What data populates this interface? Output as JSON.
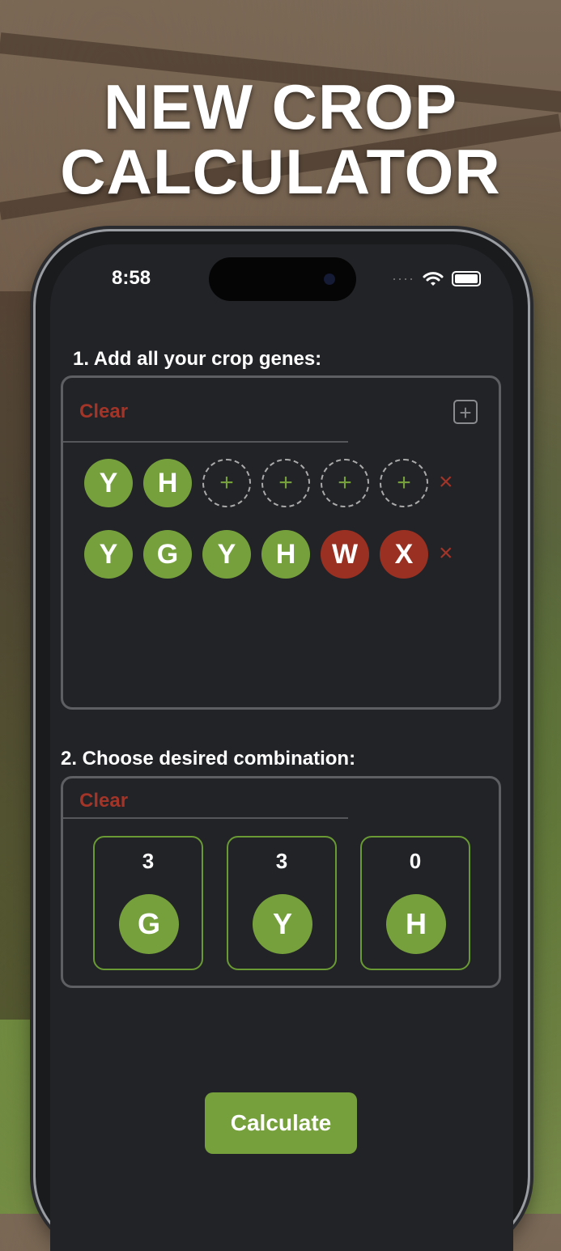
{
  "headline": {
    "line1": "NEW CROP",
    "line2": "CALCULATOR"
  },
  "status_bar": {
    "time": "8:58",
    "signal": "····"
  },
  "step1": {
    "label": "1. Add all your crop genes:",
    "clear": "Clear",
    "add_icon": "plus-square-icon",
    "empty_slot": "+",
    "remove": "×",
    "rows": [
      [
        "Y",
        "H",
        "+",
        "+",
        "+",
        "+"
      ],
      [
        "Y",
        "G",
        "Y",
        "H",
        "W",
        "X"
      ]
    ]
  },
  "step2": {
    "label": "2. Choose desired combination:",
    "clear": "Clear",
    "combos": [
      {
        "count": "3",
        "gene": "G"
      },
      {
        "count": "3",
        "gene": "Y"
      },
      {
        "count": "0",
        "gene": "H"
      }
    ]
  },
  "calculate": "Calculate",
  "colors": {
    "green": "#76a03c",
    "red": "#9a3022",
    "clear": "#a33428"
  }
}
